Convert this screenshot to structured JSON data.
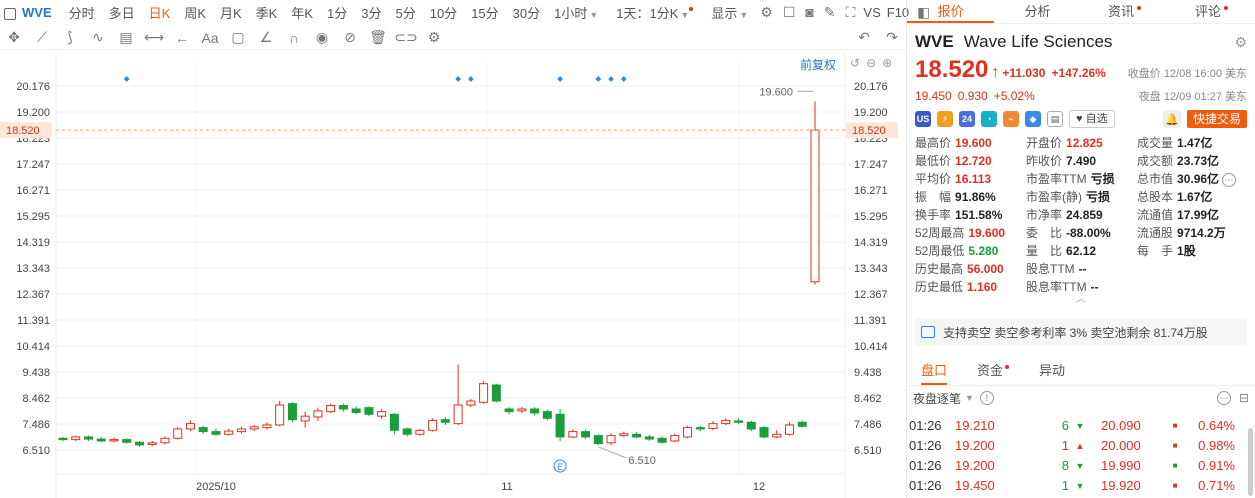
{
  "toolbar": {
    "symbol": "WVE",
    "periods": [
      "分时",
      "多日",
      "日K",
      "周K",
      "月K",
      "季K",
      "年K",
      "1分",
      "3分",
      "5分",
      "10分",
      "15分",
      "30分"
    ],
    "active_period": "日K",
    "hour_select": "1小时",
    "day_select": "1天：1分K",
    "display_label": "显示",
    "vs_label": "VS",
    "f10_label": "F10"
  },
  "chart": {
    "fuquan_label": "前复权",
    "y_ticks": [
      "20.176",
      "19.200",
      "18.223",
      "17.247",
      "16.271",
      "15.295",
      "14.319",
      "13.343",
      "12.367",
      "11.391",
      "10.414",
      "9.438",
      "8.462",
      "7.486",
      "6.510"
    ],
    "x_labels": [
      "2025/10",
      "11",
      "12"
    ],
    "current_price_tag": "18.520",
    "high_label": "19.600",
    "low_label": "6.510",
    "event_marker": "E"
  },
  "chart_data": {
    "type": "candlestick",
    "ylim": [
      6.0,
      20.5
    ],
    "current_price": 18.52,
    "candles": [
      {
        "o": 6.95,
        "c": 6.9,
        "h": 7.0,
        "l": 6.85
      },
      {
        "o": 6.9,
        "c": 7.0,
        "h": 7.05,
        "l": 6.85
      },
      {
        "o": 7.0,
        "c": 6.92,
        "h": 7.05,
        "l": 6.85
      },
      {
        "o": 6.92,
        "c": 6.85,
        "h": 7.0,
        "l": 6.8
      },
      {
        "o": 6.85,
        "c": 6.9,
        "h": 6.98,
        "l": 6.8
      },
      {
        "o": 6.9,
        "c": 6.8,
        "h": 6.95,
        "l": 6.75
      },
      {
        "o": 6.8,
        "c": 6.7,
        "h": 6.85,
        "l": 6.62
      },
      {
        "o": 6.72,
        "c": 6.78,
        "h": 6.85,
        "l": 6.65
      },
      {
        "o": 6.78,
        "c": 6.95,
        "h": 7.02,
        "l": 6.72
      },
      {
        "o": 6.95,
        "c": 7.3,
        "h": 7.38,
        "l": 6.9
      },
      {
        "o": 7.3,
        "c": 7.5,
        "h": 7.62,
        "l": 7.22
      },
      {
        "o": 7.35,
        "c": 7.2,
        "h": 7.42,
        "l": 7.12
      },
      {
        "o": 7.2,
        "c": 7.1,
        "h": 7.3,
        "l": 7.05
      },
      {
        "o": 7.1,
        "c": 7.22,
        "h": 7.3,
        "l": 7.05
      },
      {
        "o": 7.2,
        "c": 7.3,
        "h": 7.38,
        "l": 7.12
      },
      {
        "o": 7.3,
        "c": 7.38,
        "h": 7.45,
        "l": 7.22
      },
      {
        "o": 7.35,
        "c": 7.45,
        "h": 7.55,
        "l": 7.28
      },
      {
        "o": 7.45,
        "c": 8.2,
        "h": 8.35,
        "l": 7.4
      },
      {
        "o": 8.25,
        "c": 7.65,
        "h": 8.3,
        "l": 7.55
      },
      {
        "o": 7.6,
        "c": 7.78,
        "h": 7.95,
        "l": 7.35
      },
      {
        "o": 7.75,
        "c": 7.98,
        "h": 8.1,
        "l": 7.6
      },
      {
        "o": 7.95,
        "c": 8.18,
        "h": 8.25,
        "l": 7.9
      },
      {
        "o": 8.18,
        "c": 8.05,
        "h": 8.25,
        "l": 7.95
      },
      {
        "o": 8.05,
        "c": 7.92,
        "h": 8.15,
        "l": 7.85
      },
      {
        "o": 8.1,
        "c": 7.85,
        "h": 8.15,
        "l": 7.78
      },
      {
        "o": 7.78,
        "c": 7.95,
        "h": 8.05,
        "l": 7.68
      },
      {
        "o": 7.85,
        "c": 7.25,
        "h": 7.9,
        "l": 7.1
      },
      {
        "o": 7.3,
        "c": 7.1,
        "h": 7.35,
        "l": 7.02
      },
      {
        "o": 7.1,
        "c": 7.25,
        "h": 7.3,
        "l": 7.05
      },
      {
        "o": 7.25,
        "c": 7.62,
        "h": 7.7,
        "l": 7.2
      },
      {
        "o": 7.65,
        "c": 7.55,
        "h": 7.75,
        "l": 7.45
      },
      {
        "o": 7.5,
        "c": 8.2,
        "h": 9.72,
        "l": 7.45
      },
      {
        "o": 8.2,
        "c": 8.35,
        "h": 8.42,
        "l": 8.12
      },
      {
        "o": 8.3,
        "c": 9.0,
        "h": 9.1,
        "l": 8.25
      },
      {
        "o": 8.95,
        "c": 8.35,
        "h": 9.0,
        "l": 8.3
      },
      {
        "o": 8.05,
        "c": 7.95,
        "h": 8.12,
        "l": 7.85
      },
      {
        "o": 7.98,
        "c": 8.05,
        "h": 8.12,
        "l": 7.9
      },
      {
        "o": 8.05,
        "c": 7.9,
        "h": 8.12,
        "l": 7.82
      },
      {
        "o": 7.95,
        "c": 7.7,
        "h": 8.02,
        "l": 7.62
      },
      {
        "o": 7.85,
        "c": 7.0,
        "h": 8.05,
        "l": 6.85
      },
      {
        "o": 7.0,
        "c": 7.2,
        "h": 7.28,
        "l": 6.95
      },
      {
        "o": 7.2,
        "c": 7.0,
        "h": 7.28,
        "l": 6.92
      },
      {
        "o": 7.05,
        "c": 6.75,
        "h": 7.1,
        "l": 6.7
      },
      {
        "o": 6.78,
        "c": 7.05,
        "h": 7.15,
        "l": 6.7
      },
      {
        "o": 7.05,
        "c": 7.12,
        "h": 7.2,
        "l": 6.98
      },
      {
        "o": 7.1,
        "c": 7.0,
        "h": 7.18,
        "l": 6.95
      },
      {
        "o": 7.0,
        "c": 6.92,
        "h": 7.08,
        "l": 6.85
      },
      {
        "o": 6.95,
        "c": 6.8,
        "h": 7.02,
        "l": 6.75
      },
      {
        "o": 6.85,
        "c": 7.05,
        "h": 7.12,
        "l": 6.8
      },
      {
        "o": 7.0,
        "c": 7.35,
        "h": 7.42,
        "l": 6.95
      },
      {
        "o": 7.35,
        "c": 7.3,
        "h": 7.42,
        "l": 7.22
      },
      {
        "o": 7.32,
        "c": 7.5,
        "h": 7.6,
        "l": 7.25
      },
      {
        "o": 7.5,
        "c": 7.62,
        "h": 7.7,
        "l": 7.45
      },
      {
        "o": 7.6,
        "c": 7.55,
        "h": 7.7,
        "l": 7.48
      },
      {
        "o": 7.55,
        "c": 7.3,
        "h": 7.6,
        "l": 7.22
      },
      {
        "o": 7.35,
        "c": 7.0,
        "h": 7.4,
        "l": 6.95
      },
      {
        "o": 7.0,
        "c": 7.1,
        "h": 7.25,
        "l": 6.95
      },
      {
        "o": 7.1,
        "c": 7.45,
        "h": 7.55,
        "l": 7.05
      },
      {
        "o": 7.55,
        "c": 7.4,
        "h": 7.62,
        "l": 7.35
      },
      {
        "o": 12.825,
        "c": 18.52,
        "h": 19.6,
        "l": 12.72
      }
    ],
    "event_dots_at": [
      5,
      31,
      32,
      39,
      42,
      43,
      44
    ]
  },
  "panel": {
    "tabs": [
      "报价",
      "分析",
      "资讯",
      "评论"
    ],
    "active_tab": "报价",
    "code": "WVE",
    "name": "Wave Life Sciences",
    "price": "18.520",
    "change": "+11.030",
    "change_pct": "+147.26%",
    "close_note": "收盘价 12/08 16:00 美东",
    "night_price": "19.450",
    "night_change": "0.930",
    "night_pct": "+5.02%",
    "night_note": "夜盘 12/09 01:27 美东",
    "zixuan": "自选",
    "trade_btn": "快捷交易",
    "stats": [
      {
        "l": "最高价",
        "v": "19.600",
        "c": "red"
      },
      {
        "l": "开盘价",
        "v": "12.825",
        "c": "red"
      },
      {
        "l": "成交量",
        "v": "1.47亿",
        "c": ""
      },
      {
        "l": "最低价",
        "v": "12.720",
        "c": "red"
      },
      {
        "l": "昨收价",
        "v": "7.490",
        "c": ""
      },
      {
        "l": "成交额",
        "v": "23.73亿",
        "c": ""
      },
      {
        "l": "平均价",
        "v": "16.113",
        "c": "red"
      },
      {
        "l": "市盈率TTM",
        "v": "亏损",
        "c": ""
      },
      {
        "l": "总市值",
        "v": "30.96亿",
        "c": ""
      },
      {
        "l": "振　幅",
        "v": "91.86%",
        "c": ""
      },
      {
        "l": "市盈率(静)",
        "v": "亏损",
        "c": ""
      },
      {
        "l": "总股本",
        "v": "1.67亿",
        "c": ""
      },
      {
        "l": "换手率",
        "v": "151.58%",
        "c": ""
      },
      {
        "l": "市净率",
        "v": "24.859",
        "c": ""
      },
      {
        "l": "流通值",
        "v": "17.99亿",
        "c": ""
      },
      {
        "l": "52周最高",
        "v": "19.600",
        "c": "red"
      },
      {
        "l": "委　比",
        "v": "-88.00%",
        "c": ""
      },
      {
        "l": "流通股",
        "v": "9714.2万",
        "c": ""
      },
      {
        "l": "52周最低",
        "v": "5.280",
        "c": "green"
      },
      {
        "l": "量　比",
        "v": "62.12",
        "c": ""
      },
      {
        "l": "每　手",
        "v": "1股",
        "c": ""
      },
      {
        "l": "历史最高",
        "v": "56.000",
        "c": "red"
      },
      {
        "l": "股息TTM",
        "v": "--",
        "c": ""
      },
      {
        "l": "",
        "v": "",
        "c": ""
      },
      {
        "l": "历史最低",
        "v": "1.160",
        "c": "red"
      },
      {
        "l": "股息率TTM",
        "v": "--",
        "c": ""
      },
      {
        "l": "",
        "v": "",
        "c": ""
      }
    ],
    "short_info": "支持卖空  卖空参考利率 3%  卖空池剩余 81.74万股",
    "sub_tabs": [
      "盘口",
      "资金",
      "异动"
    ],
    "tick_title": "夜盘逐笔",
    "ticks": [
      {
        "t": "01:26",
        "p": "19.210",
        "v": "6",
        "d": "down",
        "bp": "20.090",
        "pct": "0.64%"
      },
      {
        "t": "01:26",
        "p": "19.200",
        "v": "1",
        "d": "up",
        "bp": "20.000",
        "pct": "0.98%"
      },
      {
        "t": "01:26",
        "p": "19.200",
        "v": "8",
        "d": "down",
        "bp": "19.990",
        "pct": "0.91%"
      },
      {
        "t": "01:26",
        "p": "19.450",
        "v": "1",
        "d": "down",
        "bp": "19.920",
        "pct": "0.71%"
      }
    ]
  }
}
